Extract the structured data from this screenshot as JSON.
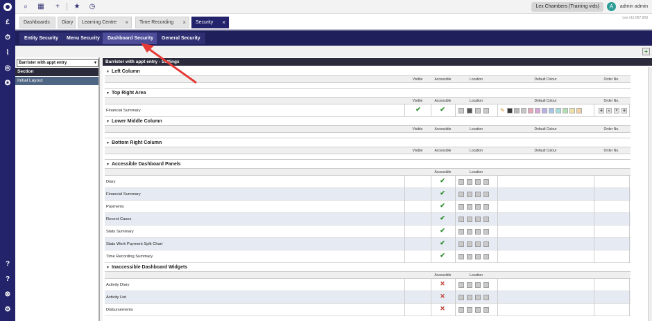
{
  "rail": {
    "icons": [
      "logo-icon",
      "pound-icon",
      "stopwatch-icon",
      "chart-icon",
      "target-icon",
      "award-icon",
      "help-icon",
      "question-icon",
      "lifebuoy-icon",
      "settings-icon"
    ]
  },
  "topbar": {
    "user_pill": "Lex Chambers (Training vids)",
    "user_initial": "A",
    "user_name": "admin admin"
  },
  "tabs": [
    {
      "label": "Dashboards"
    },
    {
      "label": "Diary"
    },
    {
      "label": "Learning Centre",
      "close": "×"
    },
    {
      "label": "Time Recording",
      "close": "×"
    },
    {
      "label": "Security",
      "close": "×",
      "active": true
    }
  ],
  "version": "Lex v11.067.003",
  "subnav": [
    "Entity Security",
    "Menu Security",
    "Dashboard Security",
    "General Security"
  ],
  "left": {
    "role": "Barrister with appt entry",
    "section_header": "Section",
    "section_item": "Initial Layout"
  },
  "right": {
    "header": "Barrister with appt entry - Settings",
    "columns": {
      "visible": "Visible",
      "accessible": "Accessible",
      "location": "Location",
      "default_colour": "Default Colour",
      "order": "Order No."
    },
    "groups": {
      "left_column": "Left Column",
      "top_right": "Top Right Area",
      "lower_middle": "Lower Middle Column",
      "bottom_right": "Bottom Right Column",
      "accessible_panels": "Accessible Dashboard Panels",
      "inaccessible_widgets": "Inaccessible Dashboard Widgets"
    },
    "top_right_rows": [
      "Financial Summary"
    ],
    "accessible_rows": [
      "Diary",
      "Financial Summary",
      "Payments",
      "Recent Cases",
      "Stats Summary",
      "Stats Work Payment Split Chart",
      "Time Recording Summary"
    ],
    "inaccessible_rows": [
      "Activity Diary",
      "Activity List",
      "Disbursements"
    ],
    "check": "✔",
    "cross": "✕",
    "swatches": [
      "#3a3a3a",
      "#b9b9b9",
      "#c6c6c6",
      "#e5a9b8",
      "#d7a8d6",
      "#b9b1e4",
      "#a9c6e6",
      "#a8dcd9",
      "#b3e0b3",
      "#eee2a6",
      "#f2cfa4"
    ]
  },
  "accent": "#23236b",
  "annotation_color": "#e53935"
}
